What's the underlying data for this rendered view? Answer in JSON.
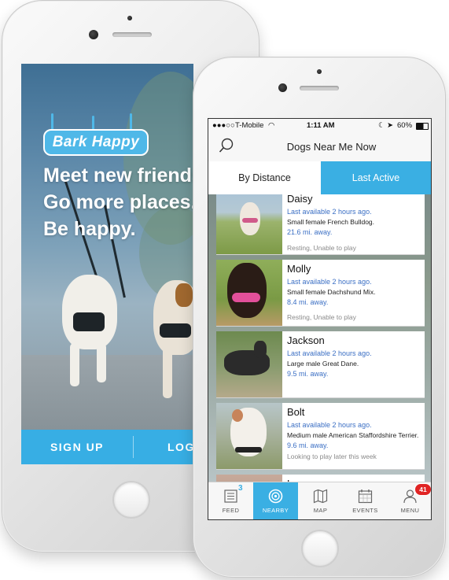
{
  "back_phone": {
    "logo_text": "Bark Happy",
    "tagline": [
      "Meet new friends.",
      "Go more places.",
      "Be happy."
    ],
    "cta": {
      "signup": "SIGN UP",
      "login": "LOG IN"
    }
  },
  "front_phone": {
    "status": {
      "carrier": "T-Mobile",
      "time": "1:11 AM",
      "battery": "60%"
    },
    "nav_title": "Dogs Near Me Now",
    "segments": {
      "left": "By Distance",
      "right": "Last Active",
      "selected": "right"
    },
    "dogs": [
      {
        "name": "Daisy",
        "available": "Last available 2 hours ago.",
        "description": "Small female French Bulldog.",
        "distance": "21.6 mi. away.",
        "status": "Resting, Unable to play"
      },
      {
        "name": "Molly",
        "available": "Last available 2 hours ago.",
        "description": "Small female Dachshund Mix.",
        "distance": "8.4 mi. away.",
        "status": "Resting, Unable to play"
      },
      {
        "name": "Jackson",
        "available": "Last available 2 hours ago.",
        "description": "Large male Great Dane.",
        "distance": "9.5 mi. away.",
        "status": ""
      },
      {
        "name": "Bolt",
        "available": "Last available 2 hours ago.",
        "description": "Medium male American Staffordshire Terrier.",
        "distance": "9.6 mi. away.",
        "status": "Looking to play later this week"
      },
      {
        "name": "Lacy",
        "available": "",
        "description": "",
        "distance": "",
        "status": ""
      }
    ],
    "tabs": [
      {
        "label": "FEED",
        "icon": "feed-icon",
        "badge": "3"
      },
      {
        "label": "NEARBY",
        "icon": "nearby-icon",
        "badge": ""
      },
      {
        "label": "MAP",
        "icon": "map-icon",
        "badge": ""
      },
      {
        "label": "EVENTS",
        "icon": "calendar-icon",
        "badge": ""
      },
      {
        "label": "MENU",
        "icon": "profile-icon",
        "badge": "41"
      }
    ],
    "active_tab": "NEARBY",
    "colors": {
      "accent": "#3aafe3",
      "link": "#3b6fc4",
      "badge": "#e02424"
    }
  }
}
